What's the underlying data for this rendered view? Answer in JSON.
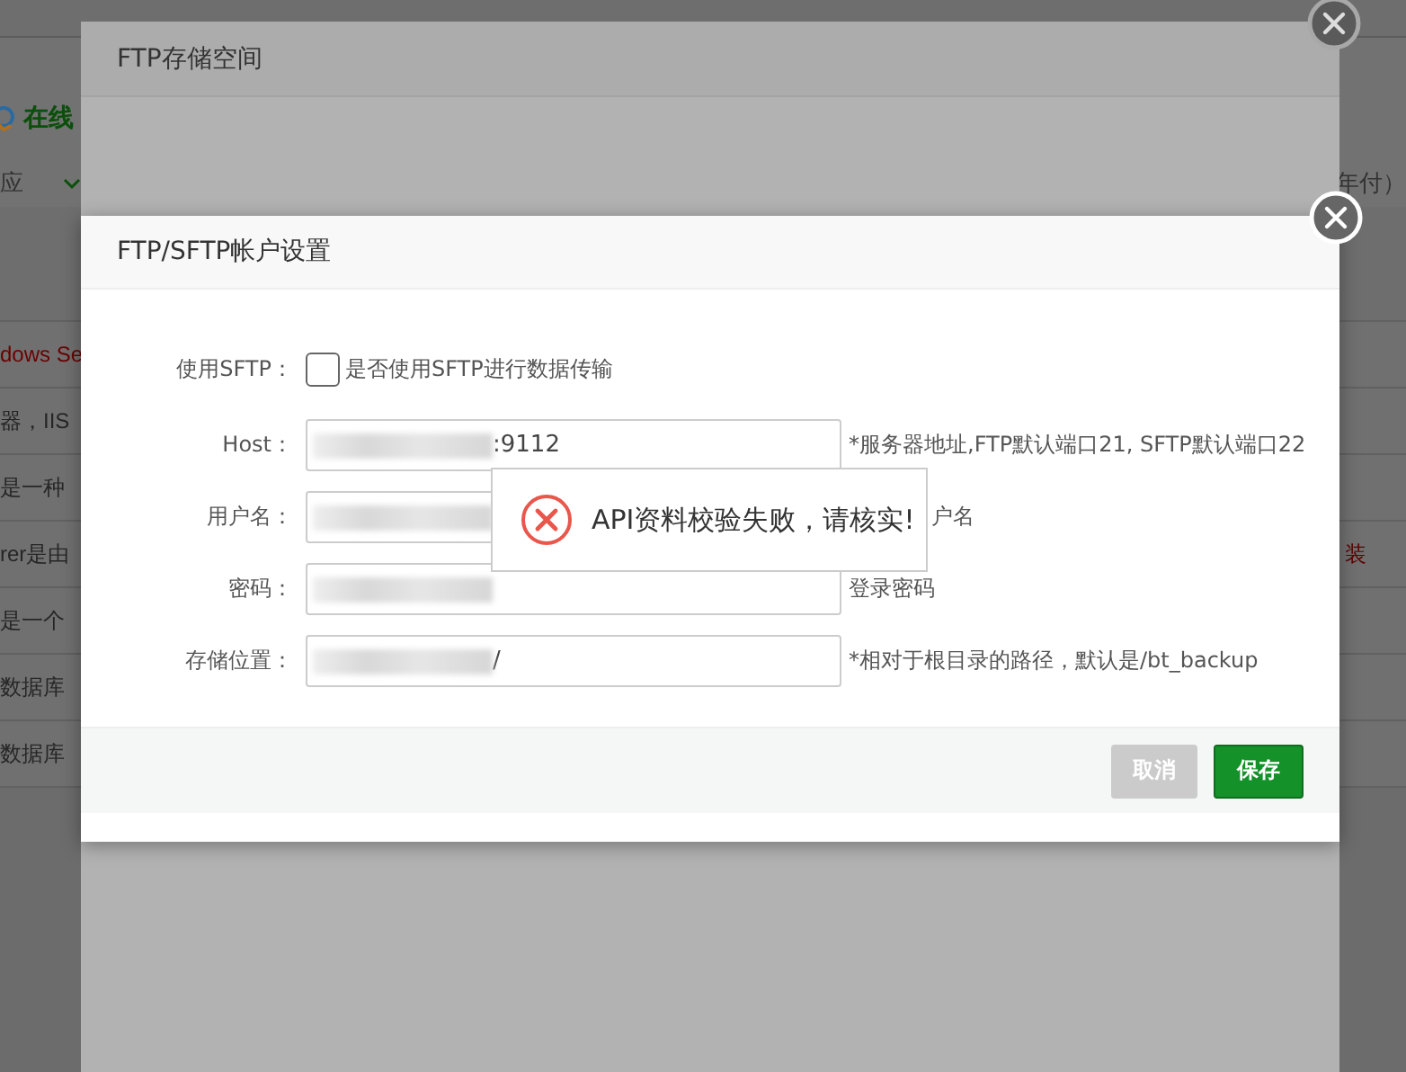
{
  "background_page": {
    "section_title": "在线",
    "menu_label": "应",
    "price_label": "年付）",
    "rows": [
      {
        "text": "dows Se",
        "kind": "link"
      },
      {
        "text": "器，IIS",
        "kind": "plain"
      },
      {
        "text": "是一种",
        "kind": "plain"
      },
      {
        "text": "rer是由",
        "kind": "plain",
        "action": "装"
      },
      {
        "text": "是一个",
        "kind": "plain"
      },
      {
        "text": "数据库",
        "kind": "plain"
      },
      {
        "text": "数据库",
        "kind": "plain"
      }
    ]
  },
  "storage_dialog": {
    "title": "FTP存储空间"
  },
  "account_dialog": {
    "title": "FTP/SFTP帐户设置",
    "sftp": {
      "label": "使用SFTP：",
      "checked": false,
      "caption": "是否使用SFTP进行数据传输"
    },
    "fields": [
      {
        "label": "Host：",
        "masked": true,
        "value": ":9112",
        "hint": "*服务器地址,FTP默认端口21, SFTP默认端口22",
        "covered": false
      },
      {
        "label": "用户名：",
        "masked": true,
        "hint": "户名",
        "covered": true
      },
      {
        "label": "密码：",
        "masked": true,
        "hint": "登录密码",
        "covered": false
      },
      {
        "label": "存储位置：",
        "masked": true,
        "value": "/",
        "hint": "*相对于根目录的路径，默认是/bt_backup",
        "covered": false
      }
    ],
    "buttons": [
      {
        "label": "取消",
        "kind": "cancel"
      },
      {
        "label": "保存",
        "kind": "primary"
      }
    ]
  },
  "toast": {
    "message": "API资料校验失败，请核实!"
  }
}
